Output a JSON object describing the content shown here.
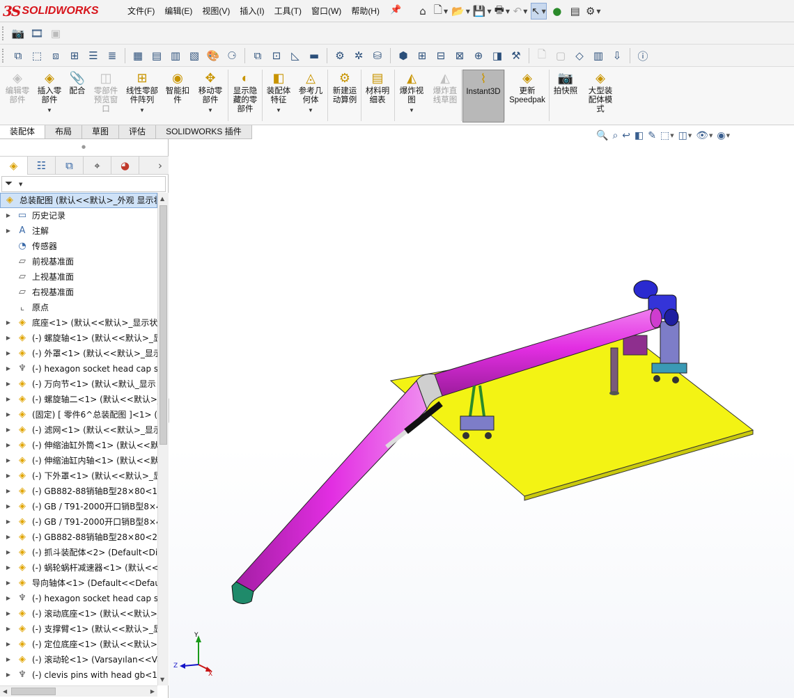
{
  "app": {
    "logo_ds": "3S",
    "logo_name": "SOLIDWORKS"
  },
  "menu": [
    "文件(F)",
    "编辑(E)",
    "视图(V)",
    "插入(I)",
    "工具(T)",
    "窗口(W)",
    "帮助(H)"
  ],
  "quick_access": [
    "home-icon",
    "new-icon",
    "open-icon",
    "save-icon",
    "print-icon",
    "undo-icon",
    "select-icon",
    "rebuild-icon",
    "file-properties-icon",
    "options-icon"
  ],
  "command_manager": [
    {
      "label": "编辑零\n部件",
      "enabled": false,
      "dropdown": false
    },
    {
      "label": "插入零\n部件",
      "enabled": true,
      "dropdown": true
    },
    {
      "label": "配合",
      "enabled": true,
      "dropdown": false
    },
    {
      "label": "零部件\n预览窗\n口",
      "enabled": false,
      "dropdown": false
    },
    {
      "label": "线性零部\n件阵列",
      "enabled": true,
      "dropdown": true
    },
    {
      "label": "智能扣\n件",
      "enabled": true,
      "dropdown": false
    },
    {
      "label": "移动零\n部件",
      "enabled": true,
      "dropdown": true
    },
    {
      "label": "显示隐\n藏的零\n部件",
      "enabled": true,
      "dropdown": false
    },
    {
      "label": "装配体\n特征",
      "enabled": true,
      "dropdown": true
    },
    {
      "label": "参考几\n何体",
      "enabled": true,
      "dropdown": true
    },
    {
      "label": "新建运\n动算例",
      "enabled": true,
      "dropdown": false
    },
    {
      "label": "材料明\n细表",
      "enabled": true,
      "dropdown": false
    },
    {
      "label": "爆炸视\n图",
      "enabled": true,
      "dropdown": true
    },
    {
      "label": "爆炸直\n线草图",
      "enabled": false,
      "dropdown": false
    },
    {
      "label": "Instant3D",
      "enabled": true,
      "dropdown": false,
      "active": true
    },
    {
      "label": "更新\nSpeedpak",
      "enabled": true,
      "dropdown": false
    },
    {
      "label": "拍快照",
      "enabled": true,
      "dropdown": false
    },
    {
      "label": "大型装\n配体模\n式",
      "enabled": true,
      "dropdown": false
    }
  ],
  "tabs": [
    "装配体",
    "布局",
    "草图",
    "评估",
    "SOLIDWORKS 插件"
  ],
  "active_tab": "装配体",
  "tree": {
    "root": "总装配图  (默认<<默认>_外观 显示状",
    "nodes": [
      {
        "label": "历史记录",
        "icon": "history-icon",
        "expand": true
      },
      {
        "label": "注解",
        "icon": "annotation-icon",
        "expand": true
      },
      {
        "label": "传感器",
        "icon": "sensor-icon",
        "expand": false
      },
      {
        "label": "前视基准面",
        "icon": "plane-icon",
        "expand": false
      },
      {
        "label": "上视基准面",
        "icon": "plane-icon",
        "expand": false
      },
      {
        "label": "右视基准面",
        "icon": "plane-icon",
        "expand": false
      },
      {
        "label": "原点",
        "icon": "origin-icon",
        "expand": false
      },
      {
        "label": "底座<1> (默认<<默认>_显示状",
        "icon": "part-icon",
        "expand": true
      },
      {
        "label": "(-) 螺旋轴<1> (默认<<默认>_显",
        "icon": "part-icon",
        "expand": true
      },
      {
        "label": "(-) 外罩<1> (默认<<默认>_显示",
        "icon": "part-icon",
        "expand": true
      },
      {
        "label": "(-) hexagon socket head cap s",
        "icon": "screw-icon",
        "expand": true
      },
      {
        "label": "(-) 万向节<1> (默认<默认_显示",
        "icon": "assembly-icon",
        "expand": true
      },
      {
        "label": "(-) 螺旋轴二<1> (默认<<默认>_",
        "icon": "part-icon",
        "expand": true
      },
      {
        "label": "(固定) [ 零件6^总装配图 ]<1> (",
        "icon": "part-icon",
        "expand": true
      },
      {
        "label": "(-) 滤网<1> (默认<<默认>_显示",
        "icon": "part-icon",
        "expand": true
      },
      {
        "label": "(-) 伸缩油缸外筒<1> (默认<<默",
        "icon": "part-icon",
        "expand": true
      },
      {
        "label": "(-) 伸缩油缸内轴<1> (默认<<默",
        "icon": "part-icon",
        "expand": true
      },
      {
        "label": "(-) 下外罩<1> (默认<<默认>_显",
        "icon": "part-icon",
        "expand": true
      },
      {
        "label": "(-) GB882-88销轴B型28×80<1:",
        "icon": "part-icon",
        "expand": true
      },
      {
        "label": "(-) GB / T91-2000开口销B型8×4",
        "icon": "part-icon",
        "expand": true
      },
      {
        "label": "(-) GB / T91-2000开口销B型8×4",
        "icon": "part-icon",
        "expand": true
      },
      {
        "label": "(-) GB882-88销轴B型28×80<2:",
        "icon": "part-icon",
        "expand": true
      },
      {
        "label": "(-) 抓斗装配体<2> (Default<Dis",
        "icon": "assembly-icon",
        "expand": true
      },
      {
        "label": "(-) 蜗轮蜗杆减速器<1> (默认<<",
        "icon": "assembly-icon",
        "expand": true
      },
      {
        "label": "导向轴体<1> (Default<<Defau",
        "icon": "part-icon",
        "expand": true
      },
      {
        "label": "(-) hexagon socket head cap s",
        "icon": "screw-icon",
        "expand": true
      },
      {
        "label": "(-) 滚动底座<1> (默认<<默认>_",
        "icon": "part-icon",
        "expand": true
      },
      {
        "label": "(-) 支撑臂<1> (默认<<默认>_显",
        "icon": "part-icon",
        "expand": true
      },
      {
        "label": "(-) 定位底座<1> (默认<<默认>_",
        "icon": "part-icon",
        "expand": true
      },
      {
        "label": "(-) 滚动轮<1> (Varsayılan<<Va",
        "icon": "part-icon",
        "expand": true
      },
      {
        "label": "(-) clevis pins with head gb<1",
        "icon": "screw-icon",
        "expand": true
      }
    ]
  },
  "triad": {
    "x": "X",
    "y": "Y",
    "z": "Z"
  },
  "colors": {
    "conveyor_tube": "#e22ee2",
    "base_plate": "#f3f314",
    "motor": "#2a2ad0",
    "support": "#7d7dc8",
    "accent": "#d7141b"
  }
}
